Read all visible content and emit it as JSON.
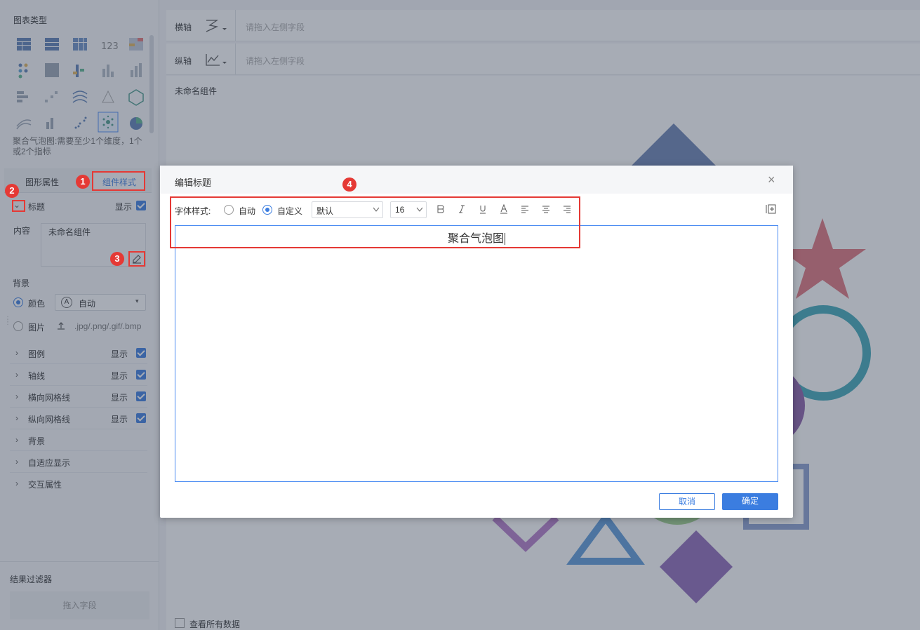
{
  "left_panel": {
    "chart_type_title": "图表类型",
    "chart_hint": "聚合气泡图:需要至少1个维度，1个或2个指标",
    "tabs": {
      "shape_props": "图形属性",
      "component_style": "组件样式"
    },
    "title_section": {
      "label": "标题",
      "show": "显示",
      "content_label": "内容",
      "content_value": "未命名组件"
    },
    "background": {
      "label": "背景",
      "color_label": "颜色",
      "auto_label": "自动",
      "image_label": "图片",
      "image_formats": ".jpg/.png/.gif/.bmp"
    },
    "rows": [
      {
        "label": "图例",
        "show": "显示"
      },
      {
        "label": "轴线",
        "show": "显示"
      },
      {
        "label": "横向网格线",
        "show": "显示"
      },
      {
        "label": "纵向网格线",
        "show": "显示"
      },
      {
        "label": "背景",
        "show": ""
      },
      {
        "label": "自适应显示",
        "show": ""
      },
      {
        "label": "交互属性",
        "show": ""
      }
    ],
    "result_filter": {
      "label": "结果过滤器",
      "drop_hint": "拖入字段"
    },
    "badges": [
      "1",
      "2",
      "3",
      "4"
    ]
  },
  "main": {
    "x_axis": {
      "label": "横轴",
      "placeholder": "请拖入左侧字段"
    },
    "y_axis": {
      "label": "纵轴",
      "placeholder": "请拖入左侧字段"
    },
    "component_name": "未命名组件",
    "view_all_data": "查看所有数据"
  },
  "dialog": {
    "title": "编辑标题",
    "font_style_label": "字体样式:",
    "radio_auto": "自动",
    "radio_custom": "自定义",
    "font_family_value": "默认",
    "font_size_value": "16",
    "editor_text": "聚合气泡图",
    "cancel_label": "取消",
    "ok_label": "确定"
  },
  "colors": {
    "accent": "#3b7de0",
    "highlight": "#e53935"
  }
}
